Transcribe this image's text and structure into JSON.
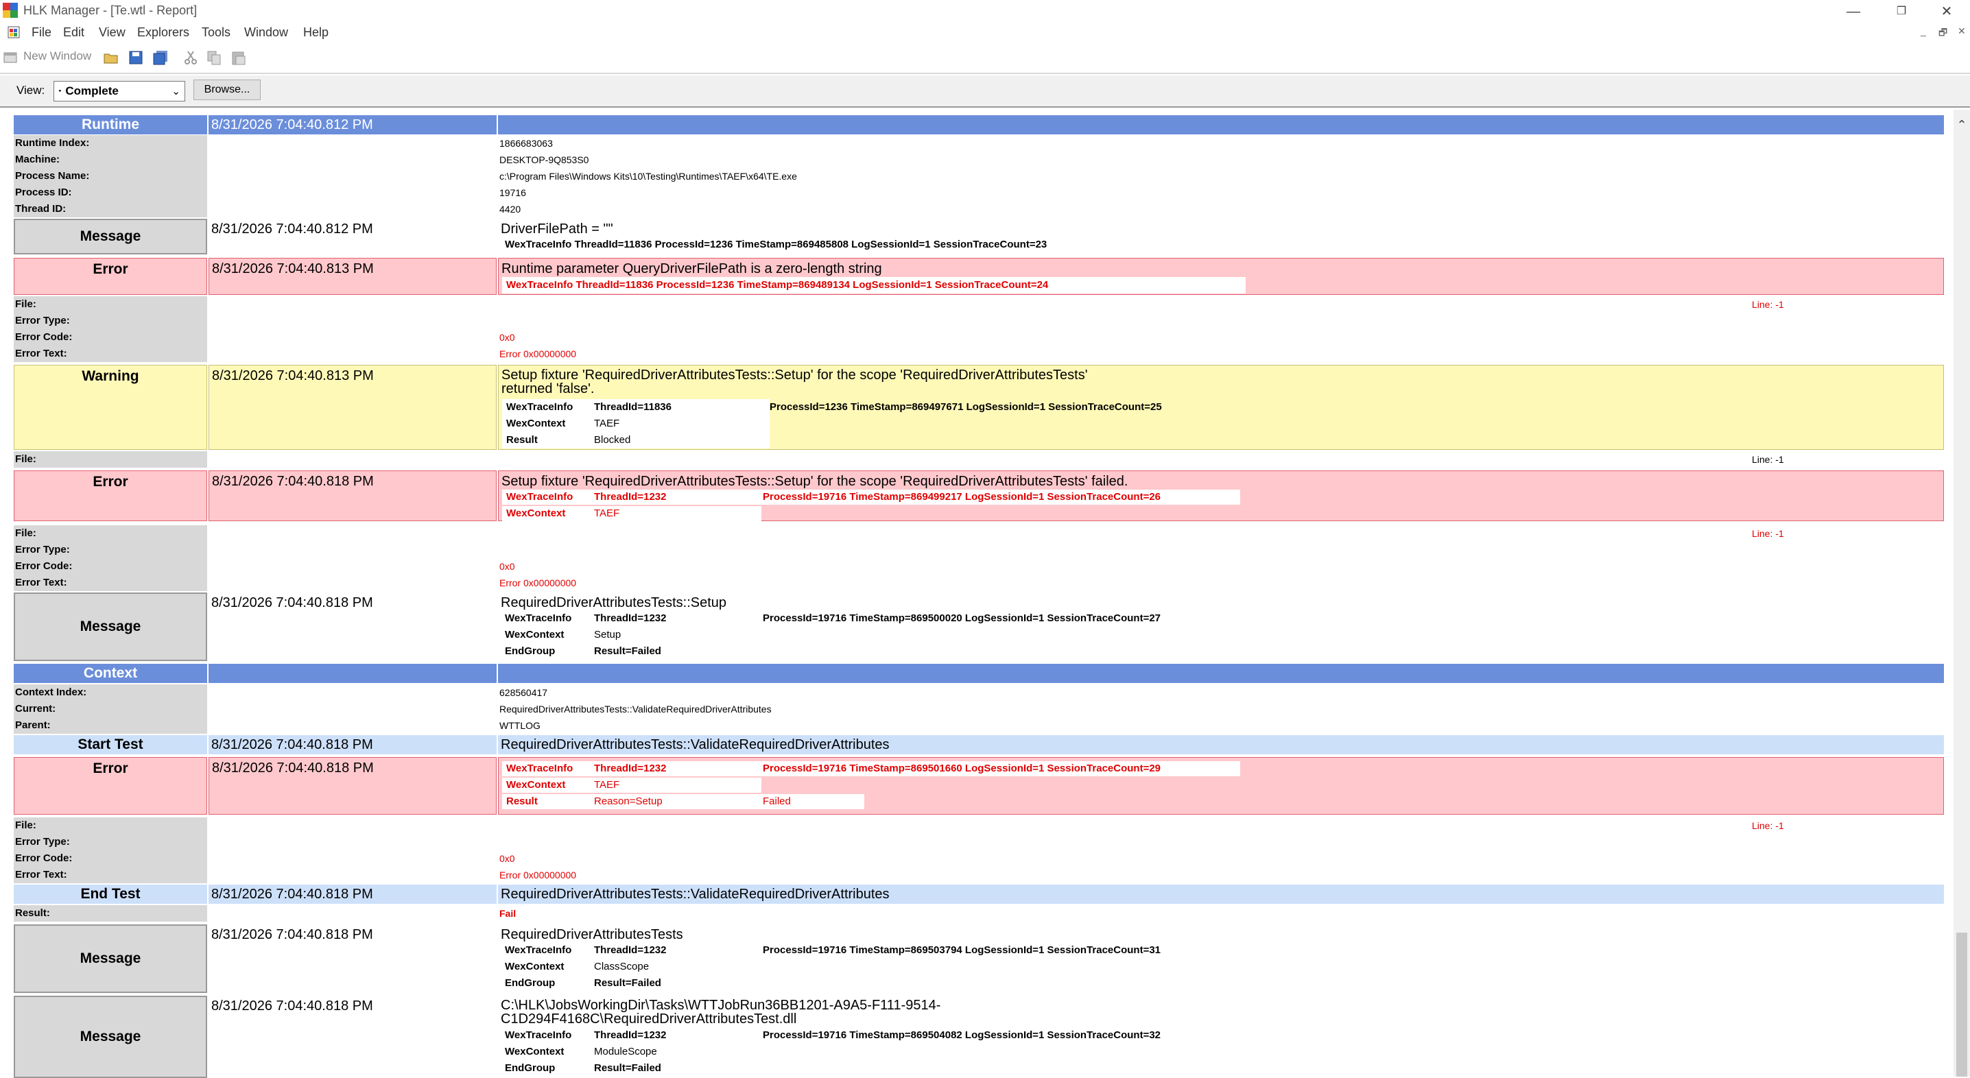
{
  "window": {
    "title": "HLK Manager - [Te.wtl - Report]",
    "minimize": "—",
    "maximize": "❐",
    "close": "✕"
  },
  "menu": {
    "items": [
      "File",
      "Edit",
      "View",
      "Explorers",
      "Tools",
      "Window",
      "Help"
    ],
    "mdi_min": "_",
    "mdi_restore": "🗗",
    "mdi_close": "✕"
  },
  "toolbar": {
    "new_window": "New Window",
    "icons": [
      "new-window-icon",
      "open-folder-icon",
      "save-icon",
      "save-all-icon",
      "cut-icon",
      "copy-icon",
      "paste-icon"
    ]
  },
  "viewbar": {
    "label": "View:",
    "selected": "· Complete",
    "browse": "Browse..."
  },
  "report": {
    "runtime": {
      "header": "Runtime",
      "time": "8/31/2026 7:04:40.812 PM",
      "props": [
        {
          "k": "Runtime Index:",
          "v": "1866683063"
        },
        {
          "k": "Machine:",
          "v": "DESKTOP-9Q853S0"
        },
        {
          "k": "Process Name:",
          "v": "c:\\Program Files\\Windows Kits\\10\\Testing\\Runtimes\\TAEF\\x64\\TE.exe"
        },
        {
          "k": "Process ID:",
          "v": "19716"
        },
        {
          "k": "Thread ID:",
          "v": "4420"
        }
      ]
    },
    "msg1": {
      "type": "Message",
      "time": "8/31/2026 7:04:40.812 PM",
      "text": "DriverFilePath = \"\"",
      "trace_key": "WexTraceInfo",
      "trace": "ThreadId=11836 ProcessId=1236 TimeStamp=869485808 LogSessionId=1 SessionTraceCount=23"
    },
    "err1": {
      "type": "Error",
      "time": "8/31/2026 7:04:40.813 PM",
      "text": "Runtime parameter QueryDriverFilePath is a zero-length string",
      "trace_key": "WexTraceInfo",
      "trace": "ThreadId=11836 ProcessId=1236 TimeStamp=869489134 LogSessionId=1 SessionTraceCount=24",
      "file_k": "File:",
      "line": "Line: -1",
      "type_k": "Error Type:",
      "code_k": "Error Code:",
      "code": "0x0",
      "text_k": "Error Text:",
      "errtext": "Error 0x00000000"
    },
    "warn1": {
      "type": "Warning",
      "time": "8/31/2026 7:04:40.813 PM",
      "text1": "Setup fixture 'RequiredDriverAttributesTests::Setup' for the scope 'RequiredDriverAttributesTests'",
      "text2": "returned 'false'.",
      "r1k": "WexTraceInfo",
      "r1a": "ThreadId=11836",
      "r1b": "ProcessId=1236 TimeStamp=869497671 LogSessionId=1 SessionTraceCount=25",
      "r2k": "WexContext",
      "r2a": "TAEF",
      "r3k": "Result",
      "r3a": "Blocked",
      "file_k": "File:",
      "line": "Line: -1"
    },
    "err2": {
      "type": "Error",
      "time": "8/31/2026 7:04:40.818 PM",
      "text": "Setup fixture 'RequiredDriverAttributesTests::Setup' for the scope 'RequiredDriverAttributesTests' failed.",
      "r1k": "WexTraceInfo",
      "r1a": "ThreadId=1232",
      "r1b": "ProcessId=19716 TimeStamp=869499217 LogSessionId=1 SessionTraceCount=26",
      "r2k": "WexContext",
      "r2a": "TAEF",
      "file_k": "File:",
      "line": "Line: -1",
      "type_k": "Error Type:",
      "code_k": "Error Code:",
      "code": "0x0",
      "text_k": "Error Text:",
      "errtext": "Error 0x00000000"
    },
    "msg2": {
      "type": "Message",
      "time": "8/31/2026 7:04:40.818 PM",
      "text": "RequiredDriverAttributesTests::Setup",
      "r1k": "WexTraceInfo",
      "r1a": "ThreadId=1232",
      "r1b": "ProcessId=19716 TimeStamp=869500020 LogSessionId=1 SessionTraceCount=27",
      "r2k": "WexContext",
      "r2a": "Setup",
      "r3k": "EndGroup",
      "r3a": "Result=Failed"
    },
    "context": {
      "header": "Context",
      "props": [
        {
          "k": "Context Index:",
          "v": "628560417"
        },
        {
          "k": "Current:",
          "v": "RequiredDriverAttributesTests::ValidateRequiredDriverAttributes"
        },
        {
          "k": "Parent:",
          "v": "WTTLOG"
        }
      ]
    },
    "start": {
      "type": "Start Test",
      "time": "8/31/2026 7:04:40.818 PM",
      "text": "RequiredDriverAttributesTests::ValidateRequiredDriverAttributes"
    },
    "err3": {
      "type": "Error",
      "time": "8/31/2026 7:04:40.818 PM",
      "r1k": "WexTraceInfo",
      "r1a": "ThreadId=1232",
      "r1b": "ProcessId=19716 TimeStamp=869501660 LogSessionId=1 SessionTraceCount=29",
      "r2k": "WexContext",
      "r2a": "TAEF",
      "r3k": "Result",
      "r3a": "Reason=Setup",
      "r3b": "Failed",
      "file_k": "File:",
      "line": "Line: -1",
      "type_k": "Error Type:",
      "code_k": "Error Code:",
      "code": "0x0",
      "text_k": "Error Text:",
      "errtext": "Error 0x00000000"
    },
    "end": {
      "type": "End Test",
      "time": "8/31/2026 7:04:40.818 PM",
      "text": "RequiredDriverAttributesTests::ValidateRequiredDriverAttributes",
      "result_k": "Result:",
      "result": "Fail"
    },
    "msg3": {
      "type": "Message",
      "time": "8/31/2026 7:04:40.818 PM",
      "text": "RequiredDriverAttributesTests",
      "r1k": "WexTraceInfo",
      "r1a": "ThreadId=1232",
      "r1b": "ProcessId=19716 TimeStamp=869503794 LogSessionId=1 SessionTraceCount=31",
      "r2k": "WexContext",
      "r2a": "ClassScope",
      "r3k": "EndGroup",
      "r3a": "Result=Failed"
    },
    "msg4": {
      "type": "Message",
      "time": "8/31/2026 7:04:40.818 PM",
      "text1": "C:\\HLK\\JobsWorkingDir\\Tasks\\WTTJobRun36BB1201-A9A5-F111-9514-",
      "text2": "C1D294F4168C\\RequiredDriverAttributesTest.dll",
      "r1k": "WexTraceInfo",
      "r1a": "ThreadId=1232",
      "r1b": "ProcessId=19716 TimeStamp=869504082 LogSessionId=1 SessionTraceCount=32",
      "r2k": "WexContext",
      "r2a": "ModuleScope",
      "r3k": "EndGroup",
      "r3a": "Result=Failed"
    }
  }
}
